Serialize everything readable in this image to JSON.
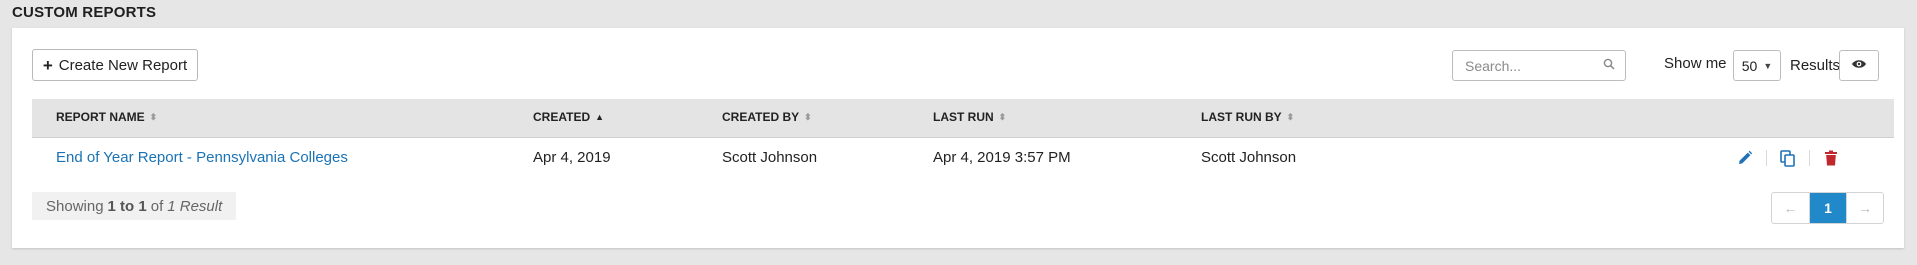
{
  "section": {
    "title": "CUSTOM REPORTS"
  },
  "toolbar": {
    "create_label": "Create New Report",
    "search_placeholder": "Search...",
    "show_me_label": "Show me",
    "per_page_value": "50",
    "results_label": "Results"
  },
  "table": {
    "columns": [
      {
        "label": "REPORT NAME",
        "sort": "none"
      },
      {
        "label": "CREATED",
        "sort": "ascending"
      },
      {
        "label": "CREATED BY",
        "sort": "none"
      },
      {
        "label": "LAST RUN",
        "sort": "none"
      },
      {
        "label": "LAST RUN BY",
        "sort": "none"
      }
    ],
    "rows": [
      {
        "report_name": "End of Year Report - Pennsylvania Colleges",
        "created": "Apr 4, 2019",
        "created_by": "Scott Johnson",
        "last_run": "Apr 4, 2019 3:57 PM",
        "last_run_by": "Scott Johnson",
        "actions": [
          "edit-icon",
          "copy-icon",
          "delete-icon"
        ]
      }
    ]
  },
  "footer": {
    "showing_prefix": "Showing",
    "showing_range": "1 to 1",
    "showing_of": "of",
    "showing_total": "1 Result",
    "current_page": "1"
  },
  "colors": {
    "link": "#1a73b5",
    "edit": "#1f72b8",
    "copy": "#1f72b8",
    "delete": "#c0282d",
    "page_active": "#2189c9"
  }
}
